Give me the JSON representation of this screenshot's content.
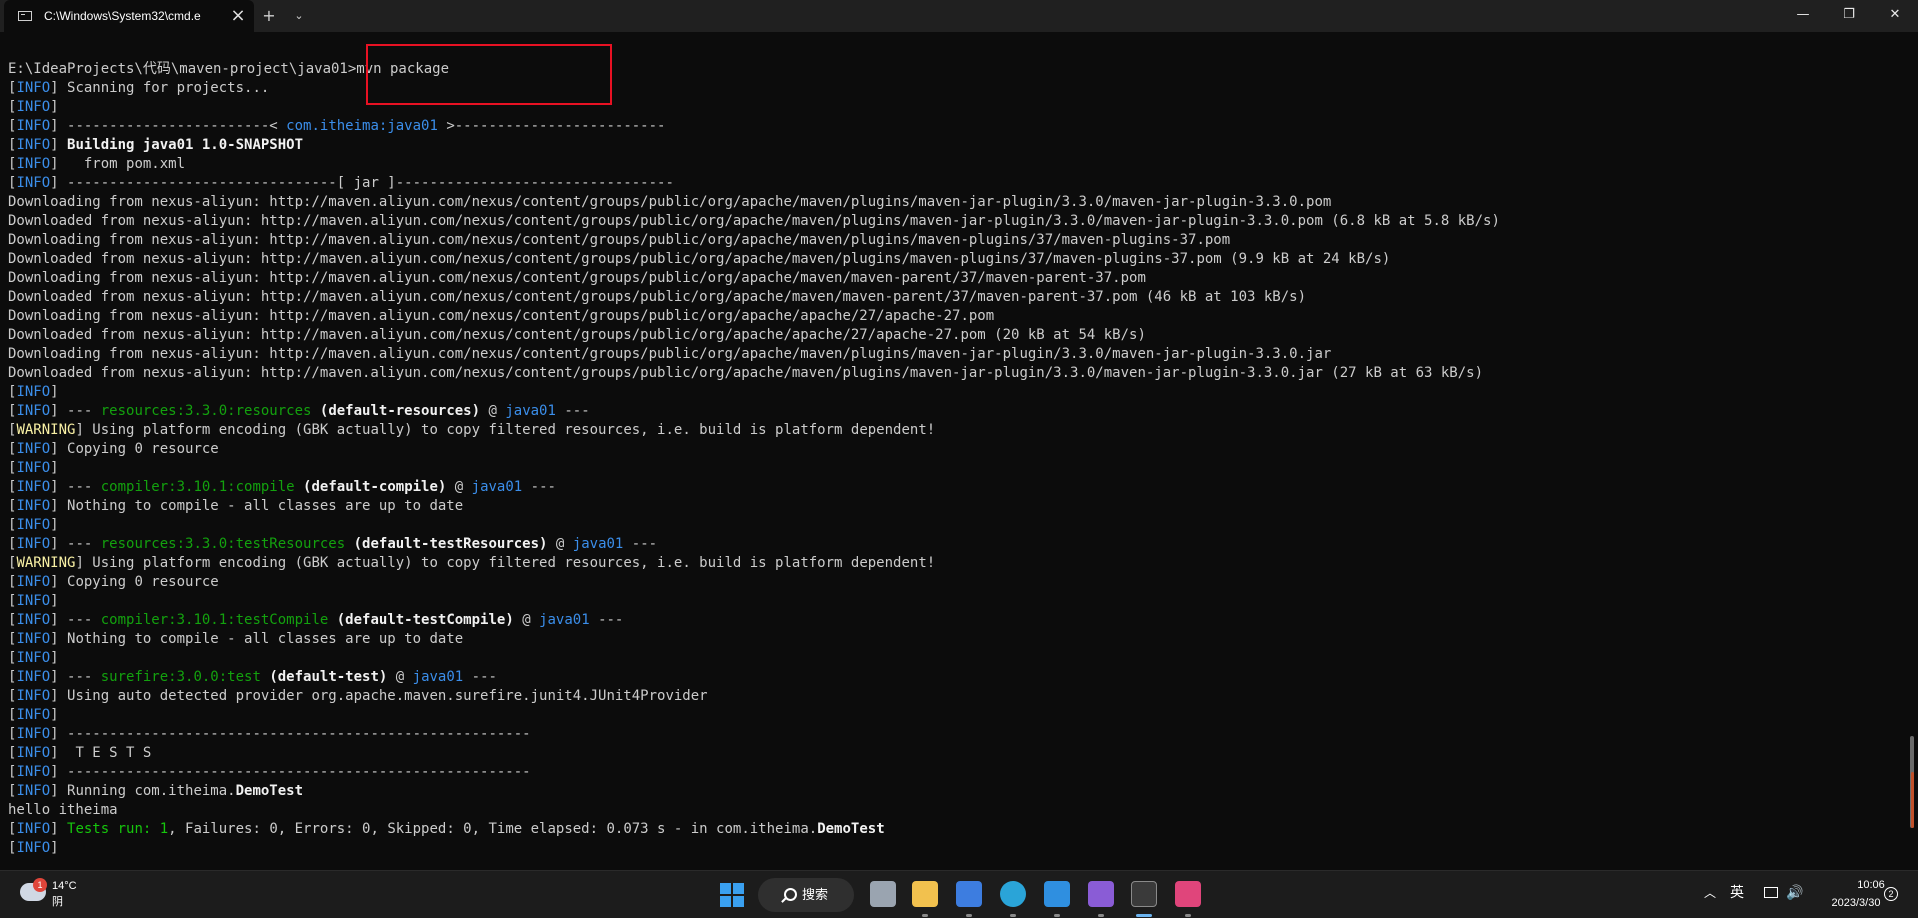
{
  "window": {
    "tab_title": "C:\\Windows\\System32\\cmd.e",
    "close_glyph": "×",
    "new_tab_glyph": "+",
    "dropdown_glyph": "⌄",
    "min_glyph": "—",
    "max_glyph": "❐",
    "close_window_glyph": "✕"
  },
  "colors": {
    "info_blue": "#3b8eea",
    "plugin_green": "#13a10e",
    "success_green": "#16c60c",
    "warning_yellow": "#f9f1a5",
    "highlight_red": "#e81123"
  },
  "terminal": {
    "lines": [
      [
        [
          "E:\\IdeaProjects\\代码\\maven-project\\java01>mvn package",
          ""
        ]
      ],
      [
        [
          "[",
          ""
        ],
        [
          "INFO",
          "blue"
        ],
        [
          "] Scanning for projects...",
          ""
        ]
      ],
      [
        [
          "[",
          ""
        ],
        [
          "INFO",
          "blue"
        ],
        [
          "]",
          ""
        ]
      ],
      [
        [
          "[",
          ""
        ],
        [
          "INFO",
          "blue"
        ],
        [
          "] ------------------------< ",
          ""
        ],
        [
          "com.itheima:java01",
          "blue"
        ],
        [
          " >-------------------------",
          ""
        ]
      ],
      [
        [
          "[",
          ""
        ],
        [
          "INFO",
          "blue"
        ],
        [
          "] ",
          ""
        ],
        [
          "Building java01 1.0-SNAPSHOT",
          "bold"
        ]
      ],
      [
        [
          "[",
          ""
        ],
        [
          "INFO",
          "blue"
        ],
        [
          "]   from pom.xml",
          ""
        ]
      ],
      [
        [
          "[",
          ""
        ],
        [
          "INFO",
          "blue"
        ],
        [
          "] --------------------------------[ jar ]---------------------------------",
          ""
        ]
      ],
      [
        [
          "Downloading from nexus-aliyun: http://maven.aliyun.com/nexus/content/groups/public/org/apache/maven/plugins/maven-jar-plugin/3.3.0/maven-jar-plugin-3.3.0.pom",
          ""
        ]
      ],
      [
        [
          "Downloaded from nexus-aliyun: http://maven.aliyun.com/nexus/content/groups/public/org/apache/maven/plugins/maven-jar-plugin/3.3.0/maven-jar-plugin-3.3.0.pom (6.8 kB at 5.8 kB/s)",
          ""
        ]
      ],
      [
        [
          "Downloading from nexus-aliyun: http://maven.aliyun.com/nexus/content/groups/public/org/apache/maven/plugins/maven-plugins/37/maven-plugins-37.pom",
          ""
        ]
      ],
      [
        [
          "Downloaded from nexus-aliyun: http://maven.aliyun.com/nexus/content/groups/public/org/apache/maven/plugins/maven-plugins/37/maven-plugins-37.pom (9.9 kB at 24 kB/s)",
          ""
        ]
      ],
      [
        [
          "Downloading from nexus-aliyun: http://maven.aliyun.com/nexus/content/groups/public/org/apache/maven/maven-parent/37/maven-parent-37.pom",
          ""
        ]
      ],
      [
        [
          "Downloaded from nexus-aliyun: http://maven.aliyun.com/nexus/content/groups/public/org/apache/maven/maven-parent/37/maven-parent-37.pom (46 kB at 103 kB/s)",
          ""
        ]
      ],
      [
        [
          "Downloading from nexus-aliyun: http://maven.aliyun.com/nexus/content/groups/public/org/apache/apache/27/apache-27.pom",
          ""
        ]
      ],
      [
        [
          "Downloaded from nexus-aliyun: http://maven.aliyun.com/nexus/content/groups/public/org/apache/apache/27/apache-27.pom (20 kB at 54 kB/s)",
          ""
        ]
      ],
      [
        [
          "Downloading from nexus-aliyun: http://maven.aliyun.com/nexus/content/groups/public/org/apache/maven/plugins/maven-jar-plugin/3.3.0/maven-jar-plugin-3.3.0.jar",
          ""
        ]
      ],
      [
        [
          "Downloaded from nexus-aliyun: http://maven.aliyun.com/nexus/content/groups/public/org/apache/maven/plugins/maven-jar-plugin/3.3.0/maven-jar-plugin-3.3.0.jar (27 kB at 63 kB/s)",
          ""
        ]
      ],
      [
        [
          "[",
          ""
        ],
        [
          "INFO",
          "blue"
        ],
        [
          "]",
          ""
        ]
      ],
      [
        [
          "[",
          ""
        ],
        [
          "INFO",
          "blue"
        ],
        [
          "] --- ",
          ""
        ],
        [
          "resources:3.3.0:resources",
          "green"
        ],
        [
          " ",
          ""
        ],
        [
          "(default-resources)",
          "bold"
        ],
        [
          " @ ",
          ""
        ],
        [
          "java01",
          "blue"
        ],
        [
          " ---",
          ""
        ]
      ],
      [
        [
          "[",
          ""
        ],
        [
          "WARNING",
          "yellow"
        ],
        [
          "] Using platform encoding (GBK actually) to copy filtered resources, i.e. build is platform dependent!",
          ""
        ]
      ],
      [
        [
          "[",
          ""
        ],
        [
          "INFO",
          "blue"
        ],
        [
          "] Copying 0 resource",
          ""
        ]
      ],
      [
        [
          "[",
          ""
        ],
        [
          "INFO",
          "blue"
        ],
        [
          "]",
          ""
        ]
      ],
      [
        [
          "[",
          ""
        ],
        [
          "INFO",
          "blue"
        ],
        [
          "] --- ",
          ""
        ],
        [
          "compiler:3.10.1:compile",
          "green"
        ],
        [
          " ",
          ""
        ],
        [
          "(default-compile)",
          "bold"
        ],
        [
          " @ ",
          ""
        ],
        [
          "java01",
          "blue"
        ],
        [
          " ---",
          ""
        ]
      ],
      [
        [
          "[",
          ""
        ],
        [
          "INFO",
          "blue"
        ],
        [
          "] Nothing to compile - all classes are up to date",
          ""
        ]
      ],
      [
        [
          "[",
          ""
        ],
        [
          "INFO",
          "blue"
        ],
        [
          "]",
          ""
        ]
      ],
      [
        [
          "[",
          ""
        ],
        [
          "INFO",
          "blue"
        ],
        [
          "] --- ",
          ""
        ],
        [
          "resources:3.3.0:testResources",
          "green"
        ],
        [
          " ",
          ""
        ],
        [
          "(default-testResources)",
          "bold"
        ],
        [
          " @ ",
          ""
        ],
        [
          "java01",
          "blue"
        ],
        [
          " ---",
          ""
        ]
      ],
      [
        [
          "[",
          ""
        ],
        [
          "WARNING",
          "yellow"
        ],
        [
          "] Using platform encoding (GBK actually) to copy filtered resources, i.e. build is platform dependent!",
          ""
        ]
      ],
      [
        [
          "[",
          ""
        ],
        [
          "INFO",
          "blue"
        ],
        [
          "] Copying 0 resource",
          ""
        ]
      ],
      [
        [
          "[",
          ""
        ],
        [
          "INFO",
          "blue"
        ],
        [
          "]",
          ""
        ]
      ],
      [
        [
          "[",
          ""
        ],
        [
          "INFO",
          "blue"
        ],
        [
          "] --- ",
          ""
        ],
        [
          "compiler:3.10.1:testCompile",
          "green"
        ],
        [
          " ",
          ""
        ],
        [
          "(default-testCompile)",
          "bold"
        ],
        [
          " @ ",
          ""
        ],
        [
          "java01",
          "blue"
        ],
        [
          " ---",
          ""
        ]
      ],
      [
        [
          "[",
          ""
        ],
        [
          "INFO",
          "blue"
        ],
        [
          "] Nothing to compile - all classes are up to date",
          ""
        ]
      ],
      [
        [
          "[",
          ""
        ],
        [
          "INFO",
          "blue"
        ],
        [
          "]",
          ""
        ]
      ],
      [
        [
          "[",
          ""
        ],
        [
          "INFO",
          "blue"
        ],
        [
          "] --- ",
          ""
        ],
        [
          "surefire:3.0.0:test",
          "green"
        ],
        [
          " ",
          ""
        ],
        [
          "(default-test)",
          "bold"
        ],
        [
          " @ ",
          ""
        ],
        [
          "java01",
          "blue"
        ],
        [
          " ---",
          ""
        ]
      ],
      [
        [
          "[",
          ""
        ],
        [
          "INFO",
          "blue"
        ],
        [
          "] Using auto detected provider org.apache.maven.surefire.junit4.JUnit4Provider",
          ""
        ]
      ],
      [
        [
          "[",
          ""
        ],
        [
          "INFO",
          "blue"
        ],
        [
          "]",
          ""
        ]
      ],
      [
        [
          "[",
          ""
        ],
        [
          "INFO",
          "blue"
        ],
        [
          "] -------------------------------------------------------",
          ""
        ]
      ],
      [
        [
          "[",
          ""
        ],
        [
          "INFO",
          "blue"
        ],
        [
          "]  T E S T S",
          ""
        ]
      ],
      [
        [
          "[",
          ""
        ],
        [
          "INFO",
          "blue"
        ],
        [
          "] -------------------------------------------------------",
          ""
        ]
      ],
      [
        [
          "[",
          ""
        ],
        [
          "INFO",
          "blue"
        ],
        [
          "] Running com.itheima.",
          ""
        ],
        [
          "DemoTest",
          "bold"
        ]
      ],
      [
        [
          "hello itheima",
          ""
        ]
      ],
      [
        [
          "[",
          ""
        ],
        [
          "INFO",
          "blue"
        ],
        [
          "] ",
          ""
        ],
        [
          "Tests run: ",
          "bgreen"
        ],
        [
          "1",
          "bgreen"
        ],
        [
          ", Failures: 0, Errors: 0, Skipped: 0, Time elapsed: 0.073 s - in com.itheima.",
          ""
        ],
        [
          "DemoTest",
          "bold"
        ]
      ],
      [
        [
          "[",
          ""
        ],
        [
          "INFO",
          "blue"
        ],
        [
          "]",
          ""
        ]
      ]
    ]
  },
  "taskbar": {
    "weather_badge": "1",
    "weather_temp": "14°C",
    "weather_desc": "阴",
    "search_label": "搜索",
    "apps": [
      {
        "name": "start-button"
      },
      {
        "name": "task-view",
        "color": "#9aa4b0"
      },
      {
        "name": "file-explorer",
        "color": "#f2c14e"
      },
      {
        "name": "microsoft-store",
        "color": "#3d7de0"
      },
      {
        "name": "edge-browser",
        "color": "#2aa4d8"
      },
      {
        "name": "vscode",
        "color": "#2f8fe0"
      },
      {
        "name": "visual-studio",
        "color": "#8a5cd6"
      },
      {
        "name": "windows-terminal",
        "color": "#3a3a3a"
      },
      {
        "name": "intellij-idea",
        "color": "#e0457b"
      }
    ],
    "tray_chevron": "︿",
    "ime": "英",
    "volume_glyph": "🔊",
    "clock_time": "10:06",
    "clock_date": "2023/3/30",
    "notification_count": "2"
  }
}
